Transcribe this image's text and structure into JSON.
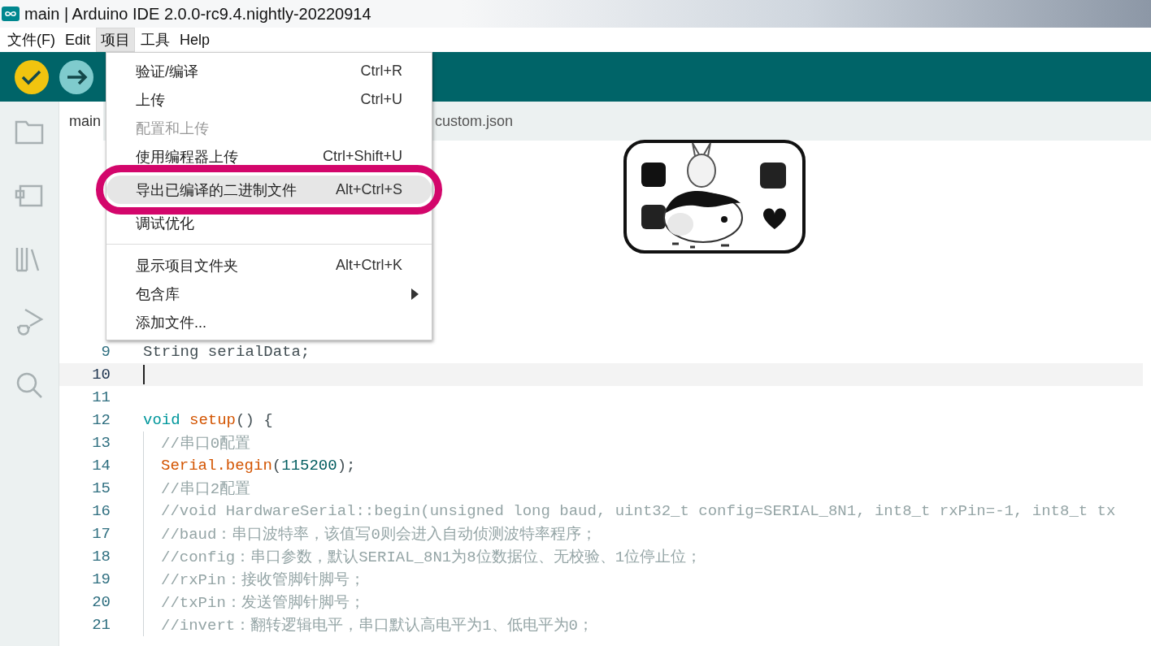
{
  "window": {
    "title": "main | Arduino IDE 2.0.0-rc9.4.nightly-20220914"
  },
  "menubar": [
    {
      "label": "文件(F)",
      "selected": false
    },
    {
      "label": "Edit",
      "selected": false
    },
    {
      "label": "项目",
      "selected": true
    },
    {
      "label": "工具",
      "selected": false
    },
    {
      "label": "Help",
      "selected": false
    }
  ],
  "toolbar": {
    "buttons": [
      {
        "kind": "verify"
      },
      {
        "kind": "upload"
      }
    ]
  },
  "sidebar": {
    "items": [
      {
        "kind": "folder"
      },
      {
        "kind": "board"
      },
      {
        "kind": "library"
      },
      {
        "kind": "debug"
      },
      {
        "kind": "search"
      }
    ]
  },
  "editor": {
    "tabs": [
      {
        "label": "main",
        "selected": true
      },
      {
        "label": "custom.json",
        "selected": false
      }
    ],
    "lines": [
      {
        "number": "9",
        "selected": false,
        "tokens": [
          {
            "kind": "plain",
            "text": "String serialData;"
          }
        ]
      },
      {
        "number": "10",
        "selected": true
      },
      {
        "number": "11",
        "selected": false
      },
      {
        "number": "12",
        "selected": false,
        "tokens": [
          {
            "kind": "keyword",
            "text": "void "
          },
          {
            "kind": "function",
            "text": "setup"
          },
          {
            "kind": "plain",
            "text": "() {"
          }
        ],
        "children": [
          {
            "number": "13",
            "selected": false,
            "tokens": [
              {
                "kind": "comment",
                "text": "//串口0配置"
              }
            ]
          },
          {
            "number": "14",
            "selected": false,
            "tokens": [
              {
                "kind": "function",
                "text": "Serial.begin"
              },
              {
                "kind": "plain",
                "text": "("
              },
              {
                "kind": "number",
                "text": "115200"
              },
              {
                "kind": "plain",
                "text": ");"
              }
            ]
          },
          {
            "number": "15",
            "selected": false,
            "tokens": [
              {
                "kind": "comment",
                "text": "//串口2配置"
              }
            ]
          },
          {
            "number": "16",
            "selected": false,
            "tokens": [
              {
                "kind": "comment",
                "text": "//void HardwareSerial::begin(unsigned long baud, uint32_t config=SERIAL_8N1, int8_t rxPin=-1, int8_t tx"
              }
            ]
          },
          {
            "number": "17",
            "selected": false,
            "tokens": [
              {
                "kind": "comment",
                "text": "//baud：串口波特率，该值写0则会进入自动侦测波特率程序；"
              }
            ]
          },
          {
            "number": "18",
            "selected": false,
            "tokens": [
              {
                "kind": "comment",
                "text": "//config：串口参数，默认SERIAL_8N1为8位数据位、无校验、1位停止位；"
              }
            ]
          },
          {
            "number": "19",
            "selected": false,
            "tokens": [
              {
                "kind": "comment",
                "text": "//rxPin：接收管脚针脚号；"
              }
            ]
          },
          {
            "number": "20",
            "selected": false,
            "tokens": [
              {
                "kind": "comment",
                "text": "//txPin：发送管脚针脚号；"
              }
            ]
          },
          {
            "number": "21",
            "selected": false,
            "tokens": [
              {
                "kind": "comment",
                "text": "//invert：翻转逻辑电平，串口默认高电平为1、低电平为0；"
              }
            ]
          }
        ]
      }
    ]
  },
  "project_menu": {
    "items": [
      {
        "kind": "item",
        "label": "验证/编译",
        "shortcut": "Ctrl+R",
        "disabled": false,
        "selected": false,
        "annotated": false
      },
      {
        "kind": "item",
        "label": "上传",
        "shortcut": "Ctrl+U",
        "disabled": false,
        "selected": false,
        "annotated": false
      },
      {
        "kind": "item",
        "label": "配置和上传",
        "disabled": true,
        "selected": false,
        "annotated": false
      },
      {
        "kind": "item",
        "label": "使用编程器上传",
        "shortcut": "Ctrl+Shift+U",
        "disabled": false,
        "selected": false,
        "annotated": false
      },
      {
        "kind": "item",
        "label": "导出已编译的二进制文件",
        "shortcut": "Alt+Ctrl+S",
        "disabled": false,
        "selected": true,
        "annotated": true
      },
      {
        "kind": "item",
        "label": "调试优化",
        "disabled": false,
        "selected": false,
        "annotated": false
      },
      {
        "kind": "separator"
      },
      {
        "kind": "item",
        "label": "显示项目文件夹",
        "shortcut": "Alt+Ctrl+K",
        "disabled": false,
        "selected": false,
        "annotated": false
      },
      {
        "kind": "submenu",
        "label": "包含库",
        "disabled": false,
        "selected": false,
        "annotated": false
      },
      {
        "kind": "item",
        "label": "添加文件...",
        "disabled": false,
        "selected": false,
        "annotated": false
      }
    ]
  }
}
